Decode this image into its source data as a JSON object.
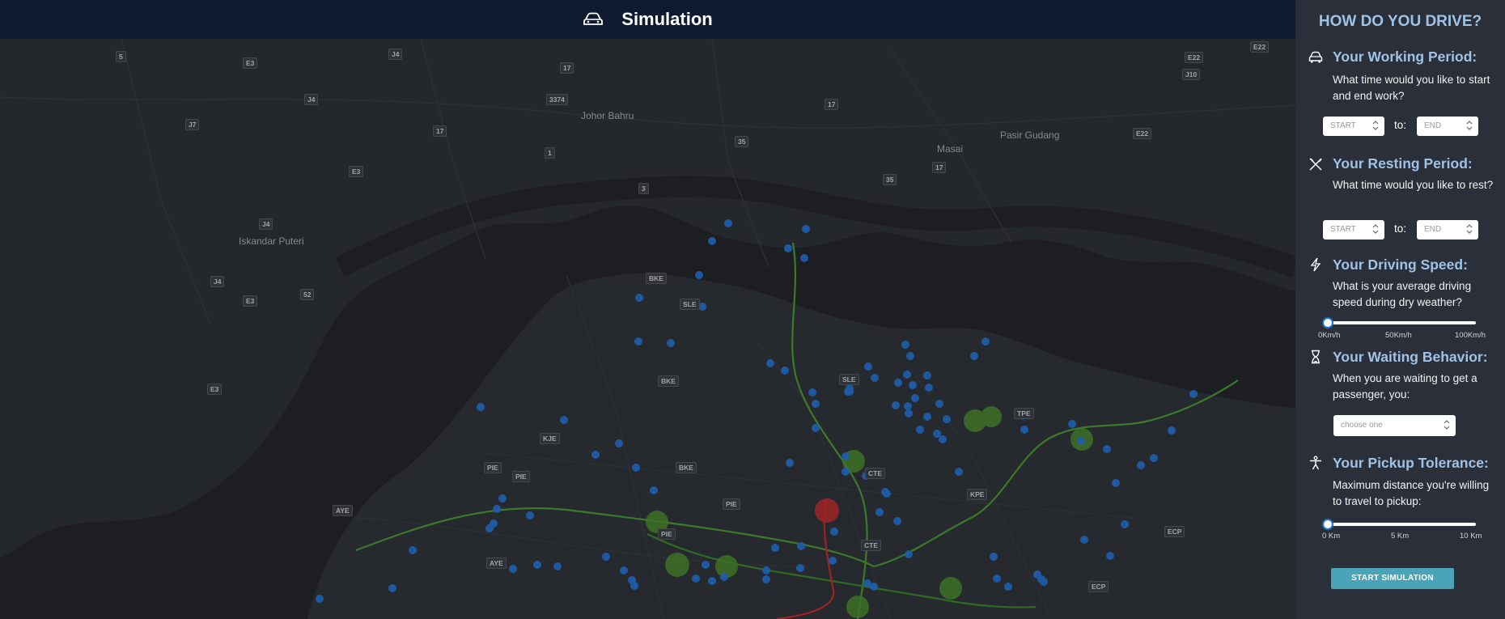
{
  "topbar": {
    "title": "Simulation",
    "icon": "car-icon"
  },
  "map": {
    "cities": [
      "Johor Bahru",
      "Iskandar Puteri",
      "Pasir Gudang",
      "Masai"
    ],
    "road_labels": [
      "5",
      "J4",
      "E3",
      "17",
      "J7",
      "J4",
      "17",
      "3374",
      "35",
      "1",
      "3",
      "E3",
      "J4",
      "J4",
      "E3",
      "52",
      "E3",
      "E22",
      "J10",
      "E22",
      "E22",
      "17",
      "35",
      "17",
      "BKE",
      "SLE",
      "BKE",
      "SLE",
      "TPE",
      "KJE",
      "PIE",
      "PIE",
      "BKE",
      "PIE",
      "AYE",
      "PIE",
      "AYE",
      "CTE",
      "KPE",
      "ECP",
      "ECP",
      "CTE"
    ],
    "colors": {
      "water": "#1c1e22",
      "land": "#26292e",
      "marker": "#1f5fae",
      "line_green": "#3b7a2a",
      "line_red": "#9e2424"
    }
  },
  "panel": {
    "title": "HOW DO YOU DRIVE?",
    "working": {
      "icon": "car-icon",
      "heading": "Your Working Period:",
      "question": "What time would you like to start and end work?",
      "start_value": "START",
      "to_label": "to:",
      "end_value": "END"
    },
    "resting": {
      "icon": "utensils-icon",
      "heading": "Your Resting Period:",
      "question": "What time would you like to rest?",
      "start_value": "START",
      "to_label": "to:",
      "end_value": "END"
    },
    "speed": {
      "icon": "lightning-icon",
      "heading": "Your Driving Speed:",
      "question": "What is your average driving speed during dry weather?",
      "value_fraction": 0,
      "ticks": [
        "0Km/h",
        "50Km/h",
        "100Km/h"
      ]
    },
    "waiting": {
      "icon": "hourglass-icon",
      "heading": "Your Waiting Behavior:",
      "question": "When you are waiting to get a passenger, you:",
      "select_value": "choose one"
    },
    "pickup": {
      "icon": "person-icon",
      "heading": "Your Pickup Tolerance:",
      "question": "Maximum distance you're willing to travel to pickup:",
      "value_fraction": 0,
      "ticks": [
        "0 Km",
        "5 Km",
        "10 Km"
      ]
    },
    "start_button": "START SIMULATION"
  }
}
